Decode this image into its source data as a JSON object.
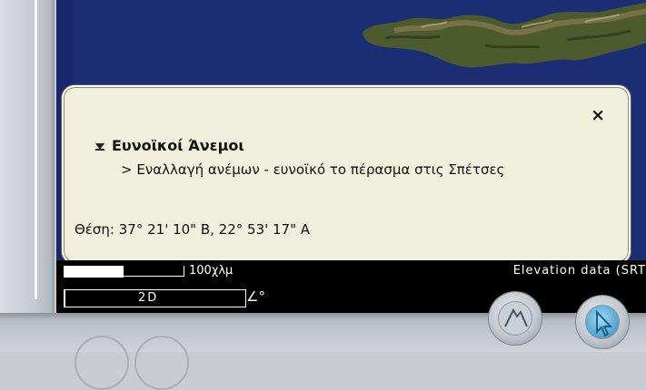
{
  "popup": {
    "close_label": "×",
    "title": "Ευνοϊκοί Άνεμοι",
    "item": "> Εναλλαγή ανέμων - ευνοϊκό το πέρασμα στις Σπέτσες",
    "position": "Θέση: 37° 21' 10\" Β, 22° 53' 17\" Α"
  },
  "status": {
    "scale_label": "100χλμ",
    "elevation_text": "Elevation data (SRT",
    "mode_label": "2D",
    "tilt_label": "∠°"
  },
  "controls": {
    "left_icon": "mountain-icon",
    "right_icon": "cursor-icon"
  },
  "colors": {
    "ocean": "#1b2e74",
    "popup_bg": "#f1f0dc",
    "accent_blue": "#57a9d4"
  }
}
